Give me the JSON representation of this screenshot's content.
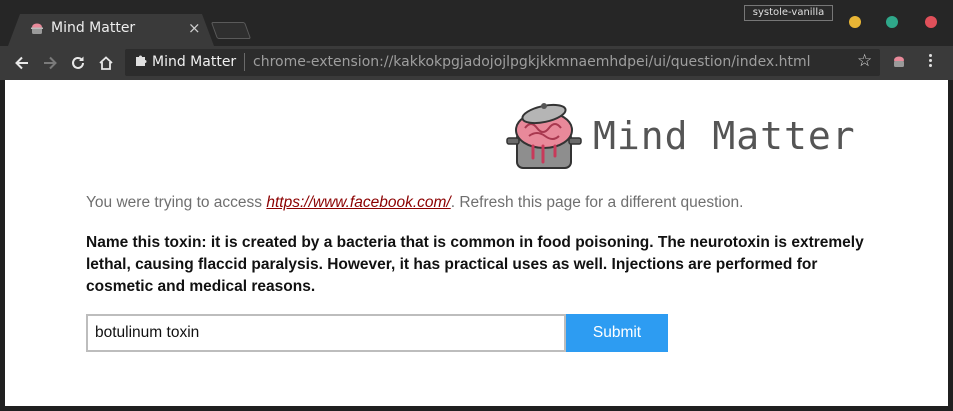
{
  "browser": {
    "tab": {
      "title": "Mind Matter",
      "favicon": "brain-pot-icon",
      "close_glyph": "×"
    },
    "profile_badge": "systole-vanilla",
    "toolbar": {
      "site_chip": "Mind Matter",
      "site_chip_icon": "extension-puzzle-icon",
      "url": "chrome-extension://kakkokpgjadojojlpgkjkkmnaemhdpei/ui/question/index.html",
      "star_glyph": "☆"
    },
    "window_controls": {
      "minimize_color": "#e8b535",
      "maximize_color": "#2fa88a",
      "close_color": "#e0505a"
    }
  },
  "page": {
    "logo": {
      "text": "Mind Matter",
      "icon": "brain-pot-icon"
    },
    "info": {
      "prefix": "You were trying to access ",
      "link": "https://www.facebook.com/",
      "suffix": ". Refresh this page for a different question."
    },
    "question": "Name this toxin: it is created by a bacteria that is common in food poisoning. The neurotoxin is extremely lethal, causing flaccid paralysis. However, it has practical uses as well. Injections are performed for cosmetic and medical reasons.",
    "answer": {
      "value": "botulinum toxin"
    },
    "submit_label": "Submit",
    "colors": {
      "accent": "#2d9cf2",
      "link": "#8b0000"
    }
  }
}
